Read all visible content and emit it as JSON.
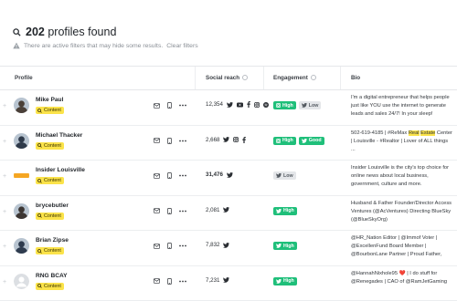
{
  "results": {
    "count": "202",
    "suffix": "profiles found",
    "filter_notice": "There are active filters that may hide some results.",
    "clear_filters": "Clear filters"
  },
  "columns": {
    "profile": "Profile",
    "reach": "Social reach",
    "engagement": "Engagement",
    "bio": "Bio"
  },
  "tag_label": "Content",
  "rows": [
    {
      "name": "Mike Paul",
      "reach": "12,354",
      "networks": [
        "twitter-icon",
        "youtube-icon",
        "facebook-icon",
        "instagram-icon",
        "spotify-icon"
      ],
      "engagement": [
        {
          "network": "instagram",
          "level": "High"
        },
        {
          "network": "twitter",
          "level": "Low"
        }
      ],
      "bio": "I'm a digital entrepreneur that helps people just like YOU use the internet to generate leads and sales 24/7! In your sleep!",
      "avatar_color": "#4a4038"
    },
    {
      "name": "Michael Thacker",
      "reach": "2,668",
      "networks": [
        "twitter-icon",
        "instagram-icon",
        "facebook-icon"
      ],
      "engagement": [
        {
          "network": "instagram",
          "level": "High"
        },
        {
          "network": "twitter",
          "level": "Good"
        }
      ],
      "bio_parts": [
        "502-619-4185 | #ReMax ",
        "Real",
        " ",
        "Estate",
        " Center | Louisville - #Realtor | Lover of ALL things ..."
      ],
      "avatar_color": "#2f3a4a"
    },
    {
      "name": "Insider Louisville",
      "reach": "31,476",
      "reach_bold": true,
      "networks": [
        "twitter-icon"
      ],
      "engagement": [
        {
          "network": "twitter",
          "level": "Low"
        }
      ],
      "bio": "Insider Louisville is the city's top choice for online news about local business, government, culture and more.",
      "avatar_color": "#f5a623"
    },
    {
      "name": "brycebutler",
      "reach": "2,081",
      "networks": [
        "twitter-icon"
      ],
      "engagement": [
        {
          "network": "twitter",
          "level": "High"
        }
      ],
      "bio": "Husband & Father Founder/Director Access Ventures (@AcVentures) Directing BlueSky (@BlueSkyOrg)",
      "avatar_color": "#3c3633"
    },
    {
      "name": "Brian Zipse",
      "reach": "7,832",
      "networks": [
        "twitter-icon"
      ],
      "engagement": [
        {
          "network": "twitter",
          "level": "High"
        }
      ],
      "bio": "@HR_Nation Editor | @Immof Voter | @ExcellenFund Board Member | @BourbonLane Partner | Proud Father,",
      "avatar_color": "#2e3b4e"
    },
    {
      "name": "RNG BCAY",
      "reach": "7,231",
      "networks": [
        "twitter-icon"
      ],
      "engagement": [
        {
          "network": "twitter",
          "level": "High"
        }
      ],
      "bio_pre": "@HannahNixhole95 ",
      "bio_post": " | I do stuff for @Renegades | CAO of @RamJetGaming",
      "heart": "❤️",
      "avatar_color": "#d5d8dc"
    }
  ],
  "colors": {
    "accent_green": "#1fbf7a",
    "tag_yellow": "#fbe34a",
    "twitter_blue": "#1da1f2"
  }
}
